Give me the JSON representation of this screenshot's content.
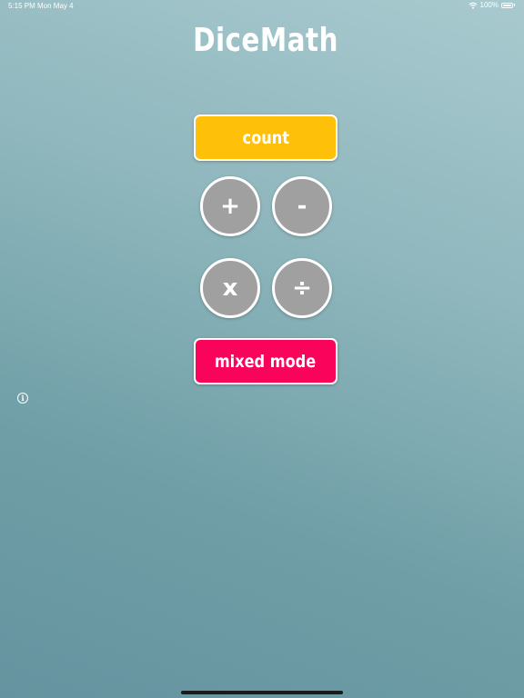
{
  "status_bar": {
    "time": "5:15 PM",
    "date": "Mon May 4",
    "battery": "100%",
    "battery_level": 1.0,
    "wifi_icon": "wifi-icon",
    "battery_icon": "battery-icon"
  },
  "app": {
    "title": "DiceMath"
  },
  "modes": {
    "count_label": "count",
    "plus_label": "+",
    "minus_label": "-",
    "times_label": "x",
    "divide_label": "÷",
    "mixed_label": "mixed mode"
  },
  "info": {
    "icon": "info-icon",
    "glyph": "i"
  },
  "colors": {
    "count": "#fec009",
    "mixed": "#f9035b",
    "operator": "#a0a0a0",
    "background_top": "#a8cacf",
    "background_bottom": "#6594a0"
  }
}
